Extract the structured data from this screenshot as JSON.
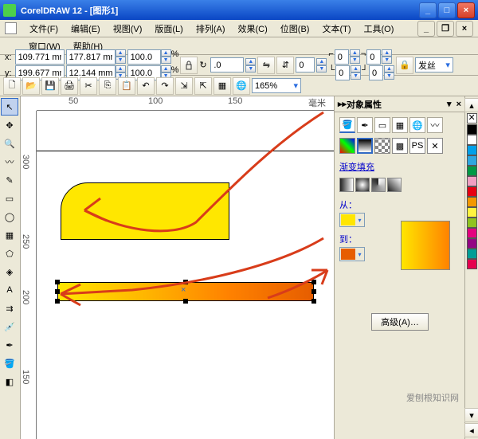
{
  "titlebar": {
    "text": "CorelDRAW 12 - [图形1]",
    "min": "_",
    "max": "□",
    "close": "×"
  },
  "menubar": {
    "file": "文件(F)",
    "edit": "编辑(E)",
    "view": "视图(V)",
    "layout": "版面(L)",
    "arrange": "排列(A)",
    "effects": "效果(C)",
    "bitmaps": "位图(B)",
    "text": "文本(T)",
    "tools": "工具(O)",
    "window": "窗口(W)",
    "help": "帮助(H)"
  },
  "propbar": {
    "x_lbl": "x:",
    "x_val": "109.771 mm",
    "y_lbl": "y:",
    "y_val": "199.677 mm",
    "w_val": "177.817 mm",
    "h_val": "12.144 mm",
    "sx": "100.0",
    "sy": "100.0",
    "pct": "%",
    "rot_lbl": "↻",
    "rot": ".0",
    "angle": "0",
    "rc1": "0",
    "rc2": "0",
    "rc3": "0",
    "rc4": "0",
    "hair": "发丝"
  },
  "stdbar": {
    "zoom": "165%"
  },
  "ruler_h": [
    "50",
    "100",
    "150",
    "毫米"
  ],
  "ruler_v": [
    "300",
    "250",
    "200",
    "150"
  ],
  "docker": {
    "title": "对象属性",
    "fill_title": "渐变填充",
    "from": "从：",
    "to": "到：",
    "advanced": "高级(A)…"
  },
  "palette_colors": [
    "#000000",
    "#ffffff",
    "#00a0e9",
    "#2ea7e0",
    "#009944",
    "#f19ec2",
    "#e60012",
    "#f39800",
    "#fff33f",
    "#8fc31f",
    "#e4007f",
    "#920783",
    "#009e96",
    "#e5004f"
  ],
  "watermark": "爱刨根知识网",
  "from_color": "#ffe600",
  "to_color": "#e65d00"
}
